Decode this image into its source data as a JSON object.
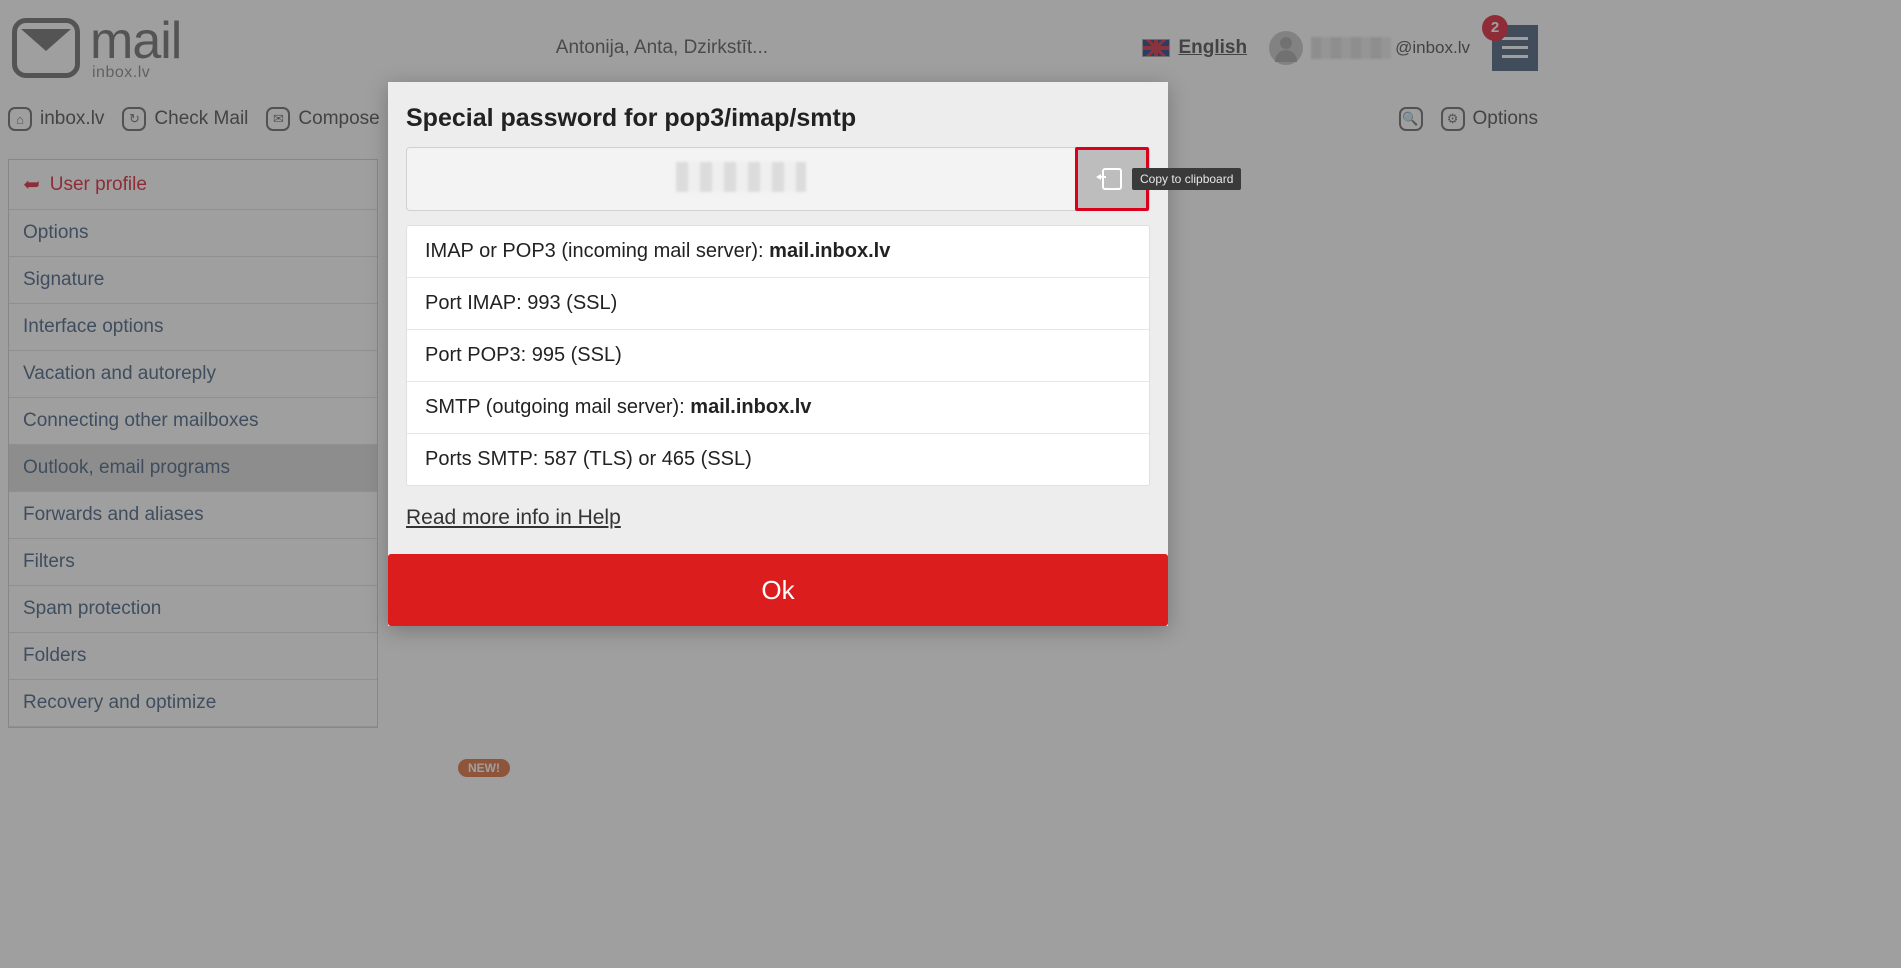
{
  "logo": {
    "brand": "mail",
    "sub": "inbox.lv"
  },
  "header": {
    "promo": "Antonija, Anta, Dzirkstīt...",
    "language": "English",
    "email_domain": "@inbox.lv",
    "notif_count": "2"
  },
  "toolbar": {
    "home": "inbox.lv",
    "check": "Check Mail",
    "compose": "Compose",
    "options": "Options"
  },
  "sidebar": {
    "back": "User profile",
    "items": [
      "Options",
      "Signature",
      "Interface options",
      "Vacation and autoreply",
      "Connecting other mailboxes",
      "Outlook, email programs",
      "Forwards and aliases",
      "Filters",
      "Spam protection",
      "Folders",
      "Recovery and optimize"
    ],
    "active_index": 5
  },
  "badge_new": "NEW!",
  "dialog": {
    "title": "Special password for pop3/imap/smtp",
    "tooltip": "Copy to clipboard",
    "rows": {
      "r1_label": "IMAP or POP3 (incoming mail server): ",
      "r1_value": "mail.inbox.lv",
      "r2": "Port IMAP: 993 (SSL)",
      "r3": "Port POP3: 995 (SSL)",
      "r4_label": "SMTP (outgoing mail server): ",
      "r4_value": "mail.inbox.lv",
      "r5": "Ports SMTP: 587 (TLS) or 465 (SSL)"
    },
    "help": "Read more info in Help",
    "ok": "Ok"
  }
}
